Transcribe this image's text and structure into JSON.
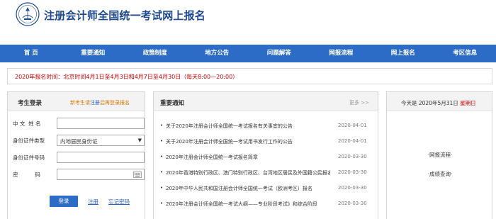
{
  "header": {
    "title": "注册会计师全国统一考试网上报名"
  },
  "nav": {
    "items": [
      "首 页",
      "重要通知",
      "政策制度",
      "地方公告",
      "问题解答",
      "网报流程",
      "网上报名",
      "考区信息"
    ]
  },
  "notice": {
    "text": "2020年报名时间：北京时间4月1日至4月3日和4月7日至4月30日（每天8:00—20:00）"
  },
  "login": {
    "title": "考生登录",
    "hint_prefix": "新考生请",
    "hint_link": "注册",
    "hint_suffix": "后再登录报名",
    "fields": {
      "name_label": "中 文  姓 名",
      "name_value": "",
      "id_type_label": "身份证件类型",
      "id_type_value": "内地居民身份证",
      "id_number_label": "身份证件号码",
      "id_number_value": "",
      "password_label": "密          码",
      "password_value": ""
    },
    "login_button": "登录",
    "register_link": "注册",
    "forgot_link": "忘记密码"
  },
  "news": {
    "title": "重要通知",
    "more": "更多 >>",
    "items": [
      {
        "text": "关于2020年注册会计师全国统一考试报名有关事宜的公告",
        "date": "2020-04-01"
      },
      {
        "text": "关于2020年注册会计师全国统一考试用书发行工作的公告",
        "date": "2020-04-01"
      },
      {
        "text": "2020年注册会计师全国统一考试报名简章",
        "date": "2020-03-30"
      },
      {
        "text": "2020年香港特别行政区、澳门特别行政区、台湾地区居民及外国籍公民报名",
        "date": "2020-03-30"
      },
      {
        "text": "2020年中华人民共和国注册会计师全国统一考试（欧洲考区）报名",
        "date": "2020-03-30"
      },
      {
        "text": "2020年注册会计师全国统一考试大纲——专业阶段考试》和综合阶段",
        "date": "2020-03-30"
      }
    ]
  },
  "side": {
    "date_text": "今天是 2020年5月31日 ",
    "weekday": "星期日",
    "links": [
      "·网报流程·",
      "·成绩查询·"
    ]
  },
  "colors": {
    "nav": "#2c6cc6",
    "title": "#1d4a8f",
    "notice": "#d40000"
  }
}
